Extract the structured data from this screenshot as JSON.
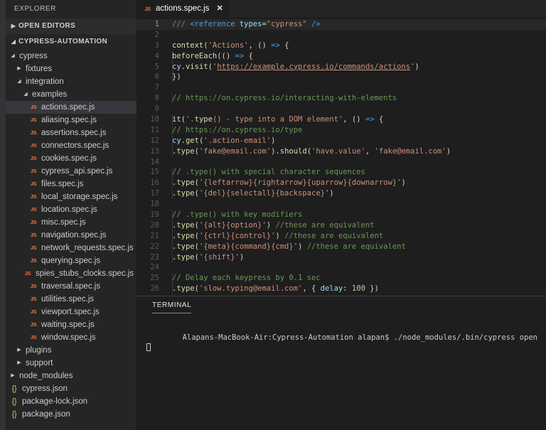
{
  "window": {
    "activity_bar_color": "#333333",
    "sidebar_color": "#252526",
    "editor_color": "#1e1e1e",
    "selection_color": "#37373d"
  },
  "sidebar": {
    "title": "EXPLORER",
    "sections": [
      {
        "label": "OPEN EDITORS",
        "expanded": false
      },
      {
        "label": "CYPRESS-AUTOMATION",
        "expanded": true
      }
    ],
    "tree": [
      {
        "label": "cypress",
        "type": "folder",
        "depth": 1,
        "expanded": true,
        "selected": false
      },
      {
        "label": "fixtures",
        "type": "folder",
        "depth": 2,
        "expanded": false,
        "selected": false
      },
      {
        "label": "integration",
        "type": "folder",
        "depth": 2,
        "expanded": true,
        "selected": false
      },
      {
        "label": "examples",
        "type": "folder",
        "depth": 3,
        "expanded": true,
        "selected": false
      },
      {
        "label": "actions.spec.js",
        "type": "js",
        "depth": 4,
        "selected": true
      },
      {
        "label": "aliasing.spec.js",
        "type": "js",
        "depth": 4,
        "selected": false
      },
      {
        "label": "assertions.spec.js",
        "type": "js",
        "depth": 4,
        "selected": false
      },
      {
        "label": "connectors.spec.js",
        "type": "js",
        "depth": 4,
        "selected": false
      },
      {
        "label": "cookies.spec.js",
        "type": "js",
        "depth": 4,
        "selected": false
      },
      {
        "label": "cypress_api.spec.js",
        "type": "js",
        "depth": 4,
        "selected": false
      },
      {
        "label": "files.spec.js",
        "type": "js",
        "depth": 4,
        "selected": false
      },
      {
        "label": "local_storage.spec.js",
        "type": "js",
        "depth": 4,
        "selected": false
      },
      {
        "label": "location.spec.js",
        "type": "js",
        "depth": 4,
        "selected": false
      },
      {
        "label": "misc.spec.js",
        "type": "js",
        "depth": 4,
        "selected": false
      },
      {
        "label": "navigation.spec.js",
        "type": "js",
        "depth": 4,
        "selected": false
      },
      {
        "label": "network_requests.spec.js",
        "type": "js",
        "depth": 4,
        "selected": false
      },
      {
        "label": "querying.spec.js",
        "type": "js",
        "depth": 4,
        "selected": false
      },
      {
        "label": "spies_stubs_clocks.spec.js",
        "type": "js",
        "depth": 4,
        "selected": false
      },
      {
        "label": "traversal.spec.js",
        "type": "js",
        "depth": 4,
        "selected": false
      },
      {
        "label": "utilities.spec.js",
        "type": "js",
        "depth": 4,
        "selected": false
      },
      {
        "label": "viewport.spec.js",
        "type": "js",
        "depth": 4,
        "selected": false
      },
      {
        "label": "waiting.spec.js",
        "type": "js",
        "depth": 4,
        "selected": false
      },
      {
        "label": "window.spec.js",
        "type": "js",
        "depth": 4,
        "selected": false
      },
      {
        "label": "plugins",
        "type": "folder",
        "depth": 2,
        "expanded": false,
        "selected": false
      },
      {
        "label": "support",
        "type": "folder",
        "depth": 2,
        "expanded": false,
        "selected": false
      },
      {
        "label": "node_modules",
        "type": "folder",
        "depth": 1,
        "expanded": false,
        "selected": false
      },
      {
        "label": "cypress.json",
        "type": "json",
        "depth": 1,
        "selected": false
      },
      {
        "label": "package-lock.json",
        "type": "json",
        "depth": 1,
        "selected": false
      },
      {
        "label": "package.json",
        "type": "json",
        "depth": 1,
        "selected": false
      }
    ]
  },
  "editor": {
    "tab": {
      "filename": "actions.spec.js",
      "icon": "JS",
      "close_glyph": "✕",
      "dirty": false
    },
    "language": "javascript",
    "first_line_number": 1,
    "last_line_number": 26,
    "active_line": 1,
    "lines": [
      {
        "n": 1,
        "text": "/// <reference types=\"cypress\" />"
      },
      {
        "n": 2,
        "text": ""
      },
      {
        "n": 3,
        "text": "context('Actions', () => {"
      },
      {
        "n": 4,
        "text": "  beforeEach(() => {"
      },
      {
        "n": 5,
        "text": "    cy.visit('https://example.cypress.io/commands/actions')"
      },
      {
        "n": 6,
        "text": "  })"
      },
      {
        "n": 7,
        "text": ""
      },
      {
        "n": 8,
        "text": "  // https://on.cypress.io/interacting-with-elements"
      },
      {
        "n": 9,
        "text": ""
      },
      {
        "n": 10,
        "text": "  it('.type() - type into a DOM element', () => {"
      },
      {
        "n": 11,
        "text": "    // https://on.cypress.io/type"
      },
      {
        "n": 12,
        "text": "    cy.get('.action-email')"
      },
      {
        "n": 13,
        "text": "      .type('fake@email.com').should('have.value', 'fake@email.com')"
      },
      {
        "n": 14,
        "text": ""
      },
      {
        "n": 15,
        "text": "      // .type() with special character sequences"
      },
      {
        "n": 16,
        "text": "      .type('{leftarrow}{rightarrow}{uparrow}{downarrow}')"
      },
      {
        "n": 17,
        "text": "      .type('{del}{selectall}{backspace}')"
      },
      {
        "n": 18,
        "text": ""
      },
      {
        "n": 19,
        "text": "      // .type() with key modifiers"
      },
      {
        "n": 20,
        "text": "      .type('{alt}{option}') //these are equivalent"
      },
      {
        "n": 21,
        "text": "      .type('{ctrl}{control}') //these are equivalent"
      },
      {
        "n": 22,
        "text": "      .type('{meta}{command}{cmd}') //these are equivalent"
      },
      {
        "n": 23,
        "text": "      .type('{shift}')"
      },
      {
        "n": 24,
        "text": ""
      },
      {
        "n": 25,
        "text": "      // Delay each keypress by 0.1 sec"
      },
      {
        "n": 26,
        "text": "      .type('slow.typing@email.com', { delay: 100 })"
      }
    ]
  },
  "panel": {
    "tabs": [
      {
        "label": "TERMINAL",
        "active": true
      }
    ],
    "terminal": {
      "prompt": "Alapans-MacBook-Air:Cypress-Automation alapan$ ",
      "command": "./node_modules/.bin/cypress open",
      "cursor": "block"
    }
  }
}
